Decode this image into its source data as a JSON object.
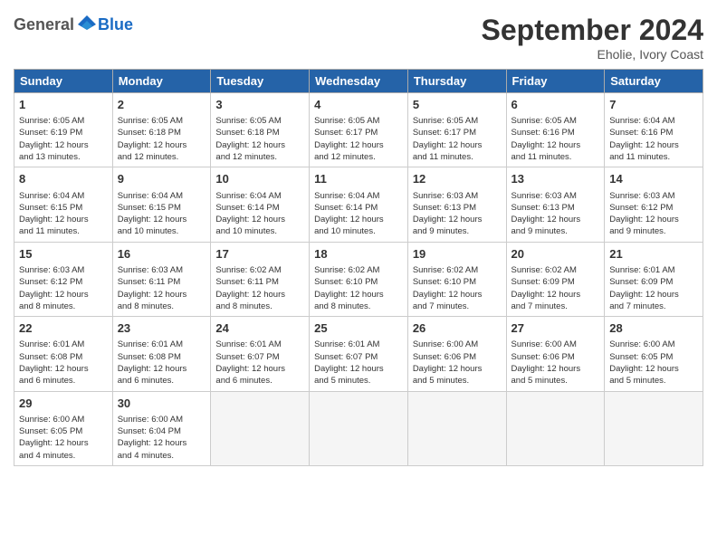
{
  "header": {
    "logo_general": "General",
    "logo_blue": "Blue",
    "month": "September 2024",
    "location": "Eholie, Ivory Coast"
  },
  "days_of_week": [
    "Sunday",
    "Monday",
    "Tuesday",
    "Wednesday",
    "Thursday",
    "Friday",
    "Saturday"
  ],
  "weeks": [
    [
      {
        "day": 1,
        "lines": [
          "Sunrise: 6:05 AM",
          "Sunset: 6:19 PM",
          "Daylight: 12 hours",
          "and 13 minutes."
        ]
      },
      {
        "day": 2,
        "lines": [
          "Sunrise: 6:05 AM",
          "Sunset: 6:18 PM",
          "Daylight: 12 hours",
          "and 12 minutes."
        ]
      },
      {
        "day": 3,
        "lines": [
          "Sunrise: 6:05 AM",
          "Sunset: 6:18 PM",
          "Daylight: 12 hours",
          "and 12 minutes."
        ]
      },
      {
        "day": 4,
        "lines": [
          "Sunrise: 6:05 AM",
          "Sunset: 6:17 PM",
          "Daylight: 12 hours",
          "and 12 minutes."
        ]
      },
      {
        "day": 5,
        "lines": [
          "Sunrise: 6:05 AM",
          "Sunset: 6:17 PM",
          "Daylight: 12 hours",
          "and 11 minutes."
        ]
      },
      {
        "day": 6,
        "lines": [
          "Sunrise: 6:05 AM",
          "Sunset: 6:16 PM",
          "Daylight: 12 hours",
          "and 11 minutes."
        ]
      },
      {
        "day": 7,
        "lines": [
          "Sunrise: 6:04 AM",
          "Sunset: 6:16 PM",
          "Daylight: 12 hours",
          "and 11 minutes."
        ]
      }
    ],
    [
      {
        "day": 8,
        "lines": [
          "Sunrise: 6:04 AM",
          "Sunset: 6:15 PM",
          "Daylight: 12 hours",
          "and 11 minutes."
        ]
      },
      {
        "day": 9,
        "lines": [
          "Sunrise: 6:04 AM",
          "Sunset: 6:15 PM",
          "Daylight: 12 hours",
          "and 10 minutes."
        ]
      },
      {
        "day": 10,
        "lines": [
          "Sunrise: 6:04 AM",
          "Sunset: 6:14 PM",
          "Daylight: 12 hours",
          "and 10 minutes."
        ]
      },
      {
        "day": 11,
        "lines": [
          "Sunrise: 6:04 AM",
          "Sunset: 6:14 PM",
          "Daylight: 12 hours",
          "and 10 minutes."
        ]
      },
      {
        "day": 12,
        "lines": [
          "Sunrise: 6:03 AM",
          "Sunset: 6:13 PM",
          "Daylight: 12 hours",
          "and 9 minutes."
        ]
      },
      {
        "day": 13,
        "lines": [
          "Sunrise: 6:03 AM",
          "Sunset: 6:13 PM",
          "Daylight: 12 hours",
          "and 9 minutes."
        ]
      },
      {
        "day": 14,
        "lines": [
          "Sunrise: 6:03 AM",
          "Sunset: 6:12 PM",
          "Daylight: 12 hours",
          "and 9 minutes."
        ]
      }
    ],
    [
      {
        "day": 15,
        "lines": [
          "Sunrise: 6:03 AM",
          "Sunset: 6:12 PM",
          "Daylight: 12 hours",
          "and 8 minutes."
        ]
      },
      {
        "day": 16,
        "lines": [
          "Sunrise: 6:03 AM",
          "Sunset: 6:11 PM",
          "Daylight: 12 hours",
          "and 8 minutes."
        ]
      },
      {
        "day": 17,
        "lines": [
          "Sunrise: 6:02 AM",
          "Sunset: 6:11 PM",
          "Daylight: 12 hours",
          "and 8 minutes."
        ]
      },
      {
        "day": 18,
        "lines": [
          "Sunrise: 6:02 AM",
          "Sunset: 6:10 PM",
          "Daylight: 12 hours",
          "and 8 minutes."
        ]
      },
      {
        "day": 19,
        "lines": [
          "Sunrise: 6:02 AM",
          "Sunset: 6:10 PM",
          "Daylight: 12 hours",
          "and 7 minutes."
        ]
      },
      {
        "day": 20,
        "lines": [
          "Sunrise: 6:02 AM",
          "Sunset: 6:09 PM",
          "Daylight: 12 hours",
          "and 7 minutes."
        ]
      },
      {
        "day": 21,
        "lines": [
          "Sunrise: 6:01 AM",
          "Sunset: 6:09 PM",
          "Daylight: 12 hours",
          "and 7 minutes."
        ]
      }
    ],
    [
      {
        "day": 22,
        "lines": [
          "Sunrise: 6:01 AM",
          "Sunset: 6:08 PM",
          "Daylight: 12 hours",
          "and 6 minutes."
        ]
      },
      {
        "day": 23,
        "lines": [
          "Sunrise: 6:01 AM",
          "Sunset: 6:08 PM",
          "Daylight: 12 hours",
          "and 6 minutes."
        ]
      },
      {
        "day": 24,
        "lines": [
          "Sunrise: 6:01 AM",
          "Sunset: 6:07 PM",
          "Daylight: 12 hours",
          "and 6 minutes."
        ]
      },
      {
        "day": 25,
        "lines": [
          "Sunrise: 6:01 AM",
          "Sunset: 6:07 PM",
          "Daylight: 12 hours",
          "and 5 minutes."
        ]
      },
      {
        "day": 26,
        "lines": [
          "Sunrise: 6:00 AM",
          "Sunset: 6:06 PM",
          "Daylight: 12 hours",
          "and 5 minutes."
        ]
      },
      {
        "day": 27,
        "lines": [
          "Sunrise: 6:00 AM",
          "Sunset: 6:06 PM",
          "Daylight: 12 hours",
          "and 5 minutes."
        ]
      },
      {
        "day": 28,
        "lines": [
          "Sunrise: 6:00 AM",
          "Sunset: 6:05 PM",
          "Daylight: 12 hours",
          "and 5 minutes."
        ]
      }
    ],
    [
      {
        "day": 29,
        "lines": [
          "Sunrise: 6:00 AM",
          "Sunset: 6:05 PM",
          "Daylight: 12 hours",
          "and 4 minutes."
        ]
      },
      {
        "day": 30,
        "lines": [
          "Sunrise: 6:00 AM",
          "Sunset: 6:04 PM",
          "Daylight: 12 hours",
          "and 4 minutes."
        ]
      },
      null,
      null,
      null,
      null,
      null
    ]
  ]
}
